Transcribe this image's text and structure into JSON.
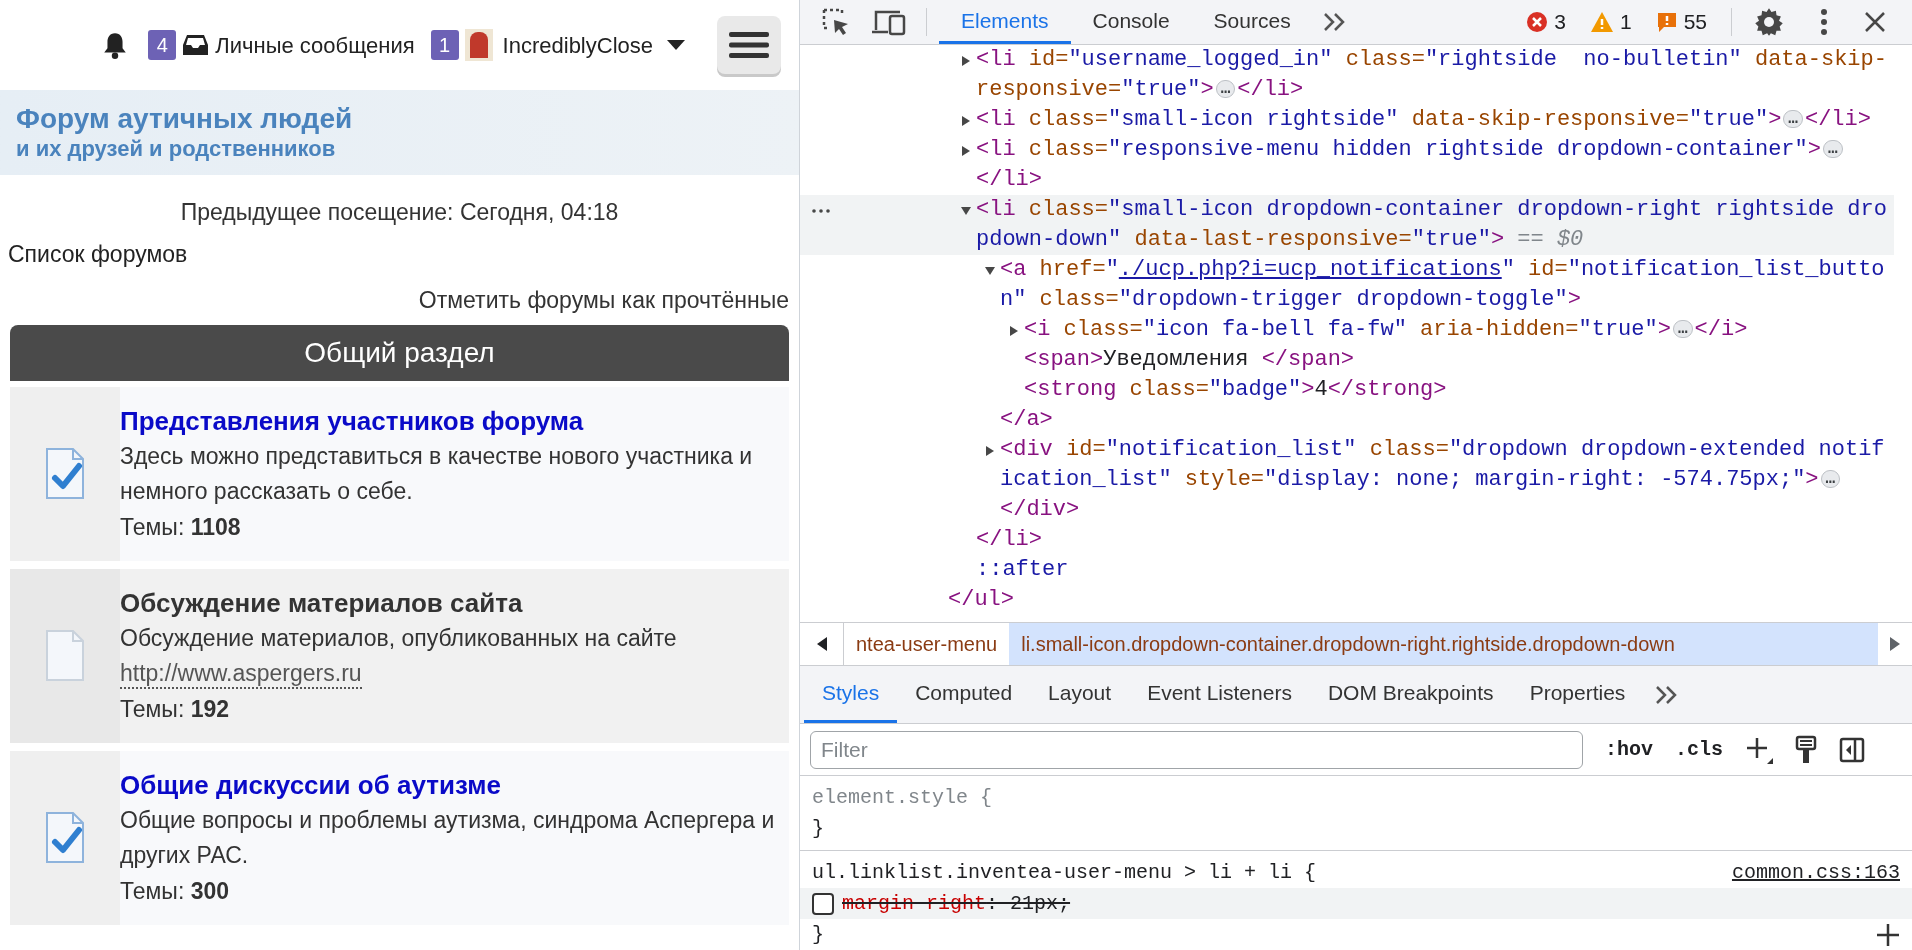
{
  "forum": {
    "top_bar": {
      "notifications_badge": "4",
      "messages_label": "Личные сообщения",
      "messages_badge": "1",
      "username": "IncrediblyClose"
    },
    "logo": {
      "line_1": "Форум аутичных людей",
      "line_2": "и их друзей и родственников"
    },
    "last_visit": "Предыдущее посещение: Сегодня, 04:18",
    "breadcrumb": "Список форумов",
    "mark_read": "Отметить форумы как прочтённые",
    "category": {
      "title": "Общий раздел",
      "forums": [
        {
          "title": "Представления участников форума",
          "unread": true,
          "description": "Здесь можно представиться в качестве нового участника и немного рассказать о себе.",
          "topics": "Темы: **1108**"
        },
        {
          "title": "Обсуждение материалов сайта",
          "unread": false,
          "description": "Обсуждение материалов, опубликованных на сайте",
          "link": "http://www.aspergers.ru",
          "topics": "Темы: **192**"
        },
        {
          "title": "Общие дискуссии об аутизме",
          "unread": true,
          "description": "Общие вопросы и проблемы аутизма, синдрома Аспергера и других РАС.",
          "topics": "Темы: **300**"
        }
      ]
    }
  },
  "devtools": {
    "tabs": [
      {
        "label": "Elements",
        "selected": true
      },
      {
        "label": "Console",
        "selected": false
      },
      {
        "label": "Sources",
        "selected": false
      }
    ],
    "errors": "3",
    "warnings": "1",
    "issues": "55",
    "dom_tree": {
      "nodes": [
        {
          "selected": false,
          "expanded": false,
          "markup": [
            {
              "kind": "tag",
              "text": "<li"
            },
            {
              "kind": "attr",
              "text": " id="
            },
            {
              "kind": "value",
              "text": "\"username_logged_in\""
            },
            {
              "kind": "attr",
              "text": " class="
            },
            {
              "kind": "value",
              "text": "\"rightside  no-bulletin\""
            },
            {
              "kind": "attr",
              "text": " data-skip-responsive="
            },
            {
              "kind": "value",
              "text": "\"true\""
            },
            {
              "kind": "tag",
              "text": ">"
            },
            {
              "kind": "ellipsis",
              "text": "…"
            },
            {
              "kind": "tag",
              "text": "</li>"
            }
          ]
        },
        {
          "selected": false,
          "expanded": false,
          "markup": [
            {
              "kind": "tag",
              "text": "<li"
            },
            {
              "kind": "attr",
              "text": " class="
            },
            {
              "kind": "value",
              "text": "\"small-icon rightside\""
            },
            {
              "kind": "attr",
              "text": " data-skip-responsive="
            },
            {
              "kind": "value",
              "text": "\"true\""
            },
            {
              "kind": "tag",
              "text": ">"
            },
            {
              "kind": "ellipsis",
              "text": "…"
            },
            {
              "kind": "tag",
              "text": "</li>"
            }
          ]
        },
        {
          "selected": false,
          "expanded": false,
          "markup": [
            {
              "kind": "tag",
              "text": "<li"
            },
            {
              "kind": "attr",
              "text": " class="
            },
            {
              "kind": "value",
              "text": "\"responsive-menu hidden rightside dropdown-container\""
            },
            {
              "kind": "tag",
              "text": ">"
            },
            {
              "kind": "ellipsis",
              "text": "…"
            },
            {
              "kind": "tag",
              "text": "</li>"
            }
          ]
        },
        {
          "selected": true,
          "expanded": true,
          "markup": [
            {
              "kind": "tag",
              "text": "<li"
            },
            {
              "kind": "attr",
              "text": " class="
            },
            {
              "kind": "value",
              "text": "\"small-icon dropdown-container dropdown-right rightside dropdown-down\""
            },
            {
              "kind": "attr",
              "text": " data-last-responsive="
            },
            {
              "kind": "value",
              "text": "\"true\""
            },
            {
              "kind": "tag",
              "text": ">"
            },
            {
              "kind": "marker",
              "text": " == $0"
            }
          ],
          "children": [
            {
              "selected": false,
              "expanded": true,
              "markup": [
                {
                  "kind": "tag",
                  "text": "<a"
                },
                {
                  "kind": "attr",
                  "text": " href="
                },
                {
                  "kind": "value",
                  "text": "\""
                },
                {
                  "kind": "link",
                  "text": "./ucp.php?i=ucp_notifications"
                },
                {
                  "kind": "value",
                  "text": "\""
                },
                {
                  "kind": "attr",
                  "text": " id="
                },
                {
                  "kind": "value",
                  "text": "\"notification_list_button\""
                },
                {
                  "kind": "attr",
                  "text": " class="
                },
                {
                  "kind": "value",
                  "text": "\"dropdown-trigger dropdown-toggle\""
                },
                {
                  "kind": "tag",
                  "text": ">"
                }
              ],
              "children": [
                {
                  "selected": false,
                  "expanded": false,
                  "markup": [
                    {
                      "kind": "tag",
                      "text": "<i"
                    },
                    {
                      "kind": "attr",
                      "text": " class="
                    },
                    {
                      "kind": "value",
                      "text": "\"icon fa-bell fa-fw\""
                    },
                    {
                      "kind": "attr",
                      "text": " aria-hidden="
                    },
                    {
                      "kind": "value",
                      "text": "\"true\""
                    },
                    {
                      "kind": "tag",
                      "text": ">"
                    },
                    {
                      "kind": "ellipsis",
                      "text": "…"
                    },
                    {
                      "kind": "tag",
                      "text": "</i>"
                    }
                  ]
                },
                {
                  "selected": false,
                  "markup": [
                    {
                      "kind": "tag",
                      "text": "<span>"
                    },
                    {
                      "kind": "text",
                      "text": "Уведомления "
                    },
                    {
                      "kind": "tag",
                      "text": "</span>"
                    }
                  ]
                },
                {
                  "selected": false,
                  "markup": [
                    {
                      "kind": "tag",
                      "text": "<strong"
                    },
                    {
                      "kind": "attr",
                      "text": " class="
                    },
                    {
                      "kind": "value",
                      "text": "\"badge\""
                    },
                    {
                      "kind": "tag",
                      "text": ">"
                    },
                    {
                      "kind": "text",
                      "text": "4"
                    },
                    {
                      "kind": "tag",
                      "text": "</strong>"
                    }
                  ]
                }
              ],
              "close": [
                {
                  "kind": "tag",
                  "text": "</a>"
                }
              ]
            },
            {
              "selected": false,
              "expanded": false,
              "markup": [
                {
                  "kind": "tag",
                  "text": "<div"
                },
                {
                  "kind": "attr",
                  "text": " id="
                },
                {
                  "kind": "value",
                  "text": "\"notification_list\""
                },
                {
                  "kind": "attr",
                  "text": " class="
                },
                {
                  "kind": "value",
                  "text": "\"dropdown dropdown-extended notification_list\""
                },
                {
                  "kind": "attr",
                  "text": " style="
                },
                {
                  "kind": "value",
                  "text": "\"display: none; margin-right: -574.75px;\""
                },
                {
                  "kind": "tag",
                  "text": ">"
                },
                {
                  "kind": "ellipsis",
                  "text": "…"
                },
                {
                  "kind": "tag",
                  "text": "</div>"
                }
              ]
            }
          ],
          "close": [
            {
              "kind": "tag",
              "text": "</li>"
            }
          ]
        },
        {
          "selected": false,
          "markup": [
            {
              "kind": "pseudo",
              "text": "::after"
            }
          ]
        }
      ],
      "trailing": [
        {
          "kind": "tag",
          "text": "</ul>"
        }
      ]
    },
    "breadcrumbs": [
      {
        "label": "ntea-user-menu",
        "selected": false
      },
      {
        "label": "li.small-icon.dropdown-container.dropdown-right.rightside.dropdown-down",
        "selected": true
      }
    ],
    "styles_tabs": [
      {
        "label": "Styles",
        "selected": true
      },
      {
        "label": "Computed",
        "selected": false
      },
      {
        "label": "Layout",
        "selected": false
      },
      {
        "label": "Event Listeners",
        "selected": false
      },
      {
        "label": "DOM Breakpoints",
        "selected": false
      },
      {
        "label": "Properties",
        "selected": false
      }
    ],
    "filter": {
      "placeholder": "Filter"
    },
    "hov": ":hov",
    "cls": ".cls",
    "rules": [
      {
        "selector": "element.style",
        "close": "}"
      },
      {
        "selector": "ul.linklist.inventea-user-menu > li + li",
        "source": "common.css:163",
        "properties": [
          {
            "name": "margin-right",
            "rest": ": 21px;",
            "enabled": false
          }
        ],
        "close": "}"
      }
    ],
    "open_brace": "{"
  }
}
